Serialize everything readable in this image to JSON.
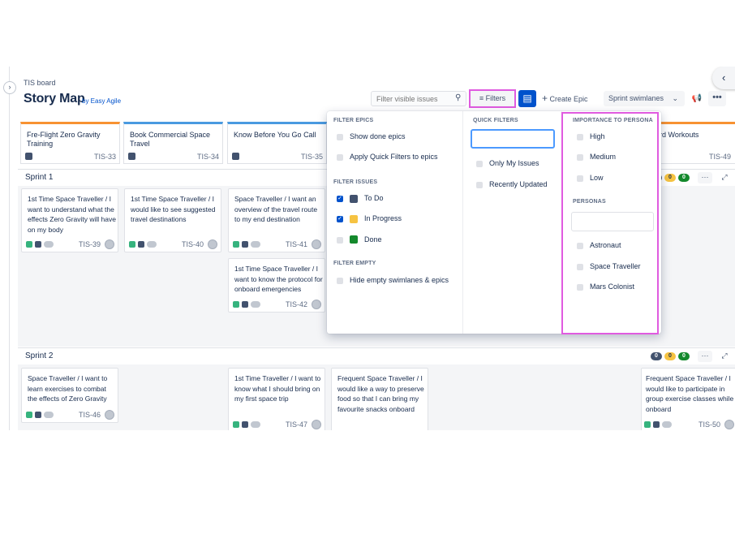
{
  "header": {
    "breadcrumb": "TIS board",
    "title": "Story Map",
    "byline": "by Easy Agile",
    "search_placeholder": "Filter visible issues",
    "filters_label": "Filters",
    "create_epic_label": "Create Epic",
    "swimlanes_label": "Sprint swimlanes",
    "more_label": "•••"
  },
  "epics": [
    {
      "title": "Fre-Flight Zero Gravity Training",
      "key": "TIS-33",
      "color": "#f79232"
    },
    {
      "title": "Book Commercial Space Travel",
      "key": "TIS-34",
      "color": "#4a9ae0"
    },
    {
      "title": "Know Before You Go Call",
      "key": "TIS-35",
      "color": "#4a9ae0"
    },
    {
      "title": "oard Workouts",
      "key": "TIS-49",
      "color": "#f79232"
    }
  ],
  "sprints": [
    {
      "name": "Sprint 1",
      "counts": [
        "0",
        "0",
        "0"
      ]
    },
    {
      "name": "Sprint 2",
      "counts": [
        "0",
        "0",
        "0"
      ]
    }
  ],
  "cards": [
    {
      "title": "1st Time Space Traveller / I want to understand what the effects Zero Gravity will have on my body",
      "key": "TIS-39"
    },
    {
      "title": "1st Time Space Traveller / I would like to see suggested travel destinations",
      "key": "TIS-40"
    },
    {
      "title": "Space Traveller / I want an overview of the travel route to my end destination",
      "key": "TIS-41"
    },
    {
      "title": "1st Time Space Traveller / I want to know the protocol for onboard emergencies",
      "key": "TIS-42"
    },
    {
      "title": "Space Traveller / I want to learn exercises to combat the effects of Zero Gravity",
      "key": "TIS-46"
    },
    {
      "title": "1st Time Traveller / I want to know what I should bring on my first space trip",
      "key": "TIS-47"
    },
    {
      "title": "Frequent Space Traveller / I would like a way to preserve food so that I can bring my favourite snacks onboard",
      "key": ""
    },
    {
      "title": "Frequent Space Traveller / I would like to participate in group exercise classes while onboard",
      "key": "TIS-50"
    }
  ],
  "filter_panel": {
    "filter_epics": {
      "heading": "FILTER EPICS",
      "options": [
        "Show done epics",
        "Apply Quick Filters to epics"
      ]
    },
    "filter_issues": {
      "heading": "FILTER ISSUES",
      "options": [
        {
          "label": "To Do",
          "color": "#42526e"
        },
        {
          "label": "In Progress",
          "color": "#f6c342"
        },
        {
          "label": "Done",
          "color": "#14892c"
        }
      ]
    },
    "filter_empty": {
      "heading": "FILTER EMPTY",
      "options": [
        "Hide empty swimlanes & epics"
      ]
    },
    "quick_filters": {
      "heading": "QUICK FILTERS",
      "options": [
        "Only My Issues",
        "Recently Updated"
      ]
    },
    "importance": {
      "heading": "IMPORTANCE TO PERSONA",
      "options": [
        "High",
        "Medium",
        "Low"
      ]
    },
    "personas": {
      "heading": "PERSONAS",
      "options": [
        "Astronaut",
        "Space Traveller",
        "Mars Colonist"
      ]
    }
  },
  "colors": {
    "accent": "#0052cc",
    "highlight": "#e05be0",
    "todo": "#42526e",
    "in_progress": "#f6c342",
    "done": "#14892c"
  }
}
